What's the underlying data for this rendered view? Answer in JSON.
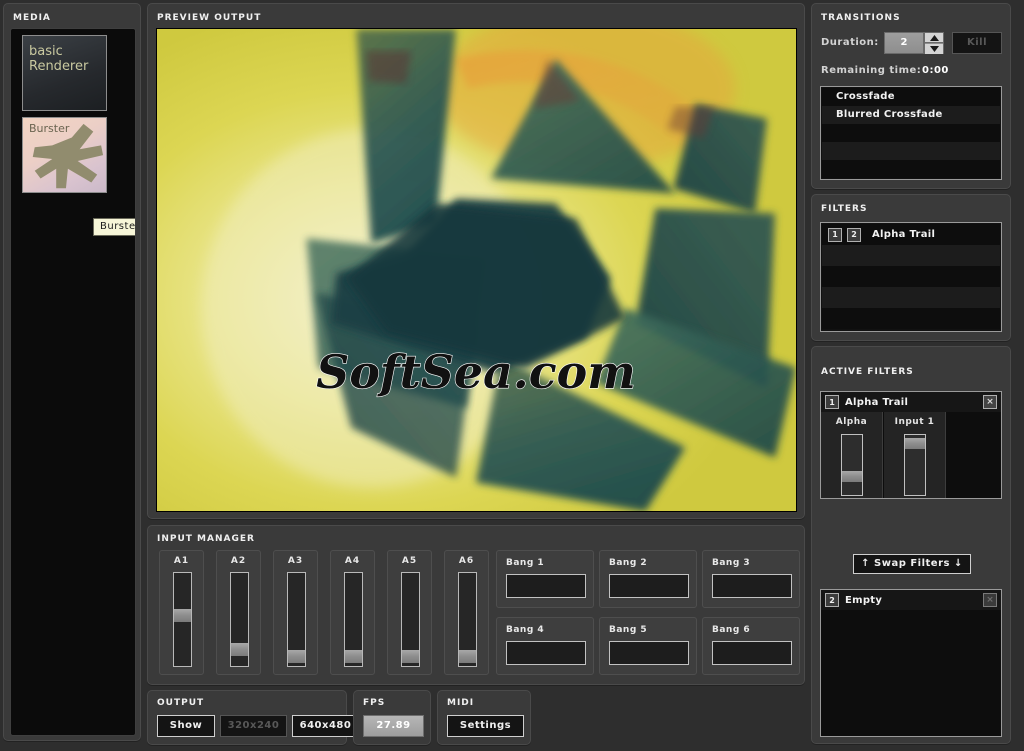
{
  "media": {
    "title": "MEDIA",
    "items": [
      {
        "label": "basic\nRenderer",
        "name": "basic-renderer"
      },
      {
        "label": "Burster",
        "name": "burster"
      }
    ],
    "tooltip": "Burster"
  },
  "preview": {
    "title": "PREVIEW OUTPUT",
    "watermark": "SoftSea.com"
  },
  "input_manager": {
    "title": "INPUT MANAGER",
    "sliders": [
      {
        "label": "A1",
        "value": 0.55
      },
      {
        "label": "A2",
        "value": 0.13
      },
      {
        "label": "A3",
        "value": 0.04
      },
      {
        "label": "A4",
        "value": 0.04
      },
      {
        "label": "A5",
        "value": 0.04
      },
      {
        "label": "A6",
        "value": 0.04
      }
    ],
    "bangs": [
      {
        "label": "Bang 1"
      },
      {
        "label": "Bang 2"
      },
      {
        "label": "Bang 3"
      },
      {
        "label": "Bang 4"
      },
      {
        "label": "Bang 5"
      },
      {
        "label": "Bang 6"
      }
    ]
  },
  "output": {
    "title": "OUTPUT",
    "show_label": "Show",
    "res_320_label": "320x240",
    "res_640_label": "640x480"
  },
  "fps": {
    "title": "FPS",
    "value": "27.89"
  },
  "midi": {
    "title": "MIDI",
    "settings_label": "Settings"
  },
  "transitions": {
    "title": "TRANSITIONS",
    "duration_label": "Duration:",
    "duration_value": "2",
    "kill_label": "Kill",
    "remaining_label": "Remaining time:",
    "remaining_value": "0:00",
    "items": [
      {
        "label": "Crossfade"
      },
      {
        "label": "Blurred Crossfade"
      },
      {
        "label": ""
      },
      {
        "label": ""
      },
      {
        "label": ""
      }
    ]
  },
  "filters": {
    "title": "FILTERS",
    "items": [
      {
        "slot_a": "1",
        "slot_b": "2",
        "label": "Alpha Trail"
      },
      {
        "slot_a": "",
        "slot_b": "",
        "label": ""
      },
      {
        "slot_a": "",
        "slot_b": "",
        "label": ""
      },
      {
        "slot_a": "",
        "slot_b": "",
        "label": ""
      },
      {
        "slot_a": "",
        "slot_b": "",
        "label": ""
      }
    ]
  },
  "active_filters": {
    "title": "ACTIVE FILTERS",
    "swap_label": "Swap Filters",
    "swap_up_icon": "↑",
    "swap_down_icon": "↓",
    "close_icon": "×",
    "slots": [
      {
        "index": "1",
        "name": "Alpha Trail",
        "params": [
          {
            "label": "Alpha",
            "value": 0.26
          },
          {
            "label": "Input 1",
            "value": 0.94
          }
        ]
      },
      {
        "index": "2",
        "name": "Empty",
        "params": []
      }
    ]
  },
  "colors": {
    "panel_bg": "#3a3a3a",
    "window_bg": "#2e2e2e",
    "inset_bg": "#111111",
    "text": "#f0f0f0",
    "accent_yellow": "#d8d44f",
    "accent_teal": "#1f4a4a"
  }
}
